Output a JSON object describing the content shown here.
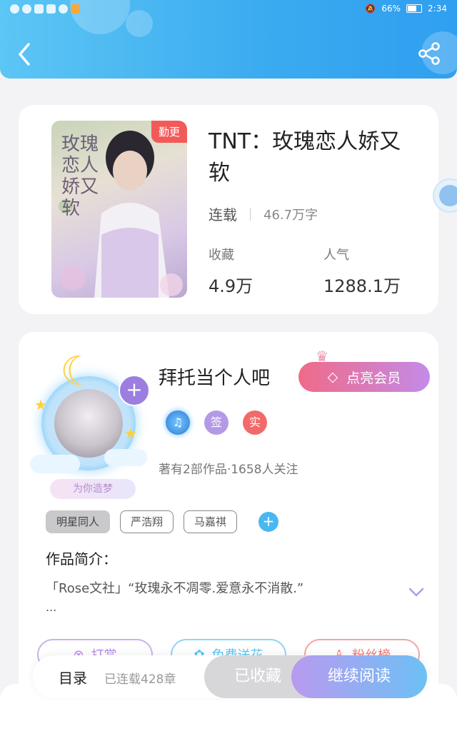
{
  "status_bar": {
    "battery": "66%",
    "time": "2:34"
  },
  "book": {
    "cover_tag": "勤更",
    "cover_title": "玫瑰恋人娇又软",
    "title": "TNT：玫瑰恋人娇又软",
    "status": "连载",
    "word_count": "46.7万字",
    "favorites_label": "收藏",
    "favorites_value": "4.9万",
    "popularity_label": "人气",
    "popularity_value": "1288.1万"
  },
  "author": {
    "name": "拜托当个人吧",
    "vip_label": "点亮会员",
    "dream_tag": "为你造梦",
    "badges": [
      "♫",
      "签",
      "实"
    ],
    "stats": "著有2部作品·1658人关注",
    "tags": [
      "明星同人",
      "严浩翔",
      "马嘉祺"
    ],
    "tag_add": "+"
  },
  "intro": {
    "label": "作品简介：",
    "text": "「Rose文社」“玫瑰永不凋零.爱意永不消散.”",
    "ellipsis": "..."
  },
  "actions": [
    {
      "label": "打赏",
      "color": "#b48be8"
    },
    {
      "label": "免费送花",
      "color": "#5cc6f4"
    },
    {
      "label": "粉丝榜",
      "color": "#f07a7a"
    }
  ],
  "bottom_bar": {
    "toc_label": "目录",
    "toc_sub": "已连载428章",
    "fav_label": "已收藏",
    "read_label": "继续阅读"
  },
  "colors": {
    "header": "#3aaaf0",
    "vip": "#f06a88",
    "accent_blue": "#49b8f1"
  }
}
